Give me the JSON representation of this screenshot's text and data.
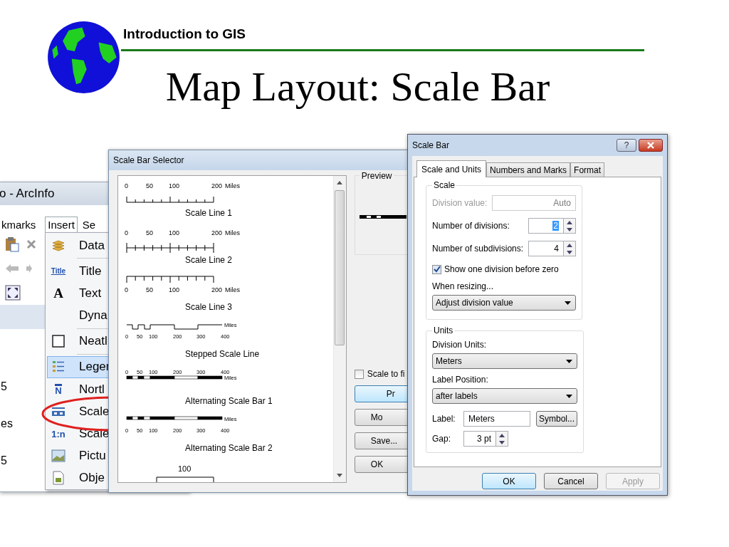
{
  "slide": {
    "header": "Introduction to GIS",
    "title": "Map Layout: Scale Bar"
  },
  "arcinfo_window": {
    "title": "o - ArcInfo",
    "menus": [
      {
        "label": "kmarks",
        "selected": false
      },
      {
        "label": "Insert",
        "selected": true
      },
      {
        "label": "Se",
        "selected": false
      }
    ],
    "side_texts": [
      "5",
      "es",
      "5"
    ],
    "insert_menu": [
      {
        "items": [
          {
            "label": "Data",
            "kind": "layers",
            "selected": false
          }
        ]
      },
      {
        "items": [
          {
            "label": "Title",
            "kind": "title",
            "icon_text": "Title",
            "selected": false
          },
          {
            "label": "Text",
            "kind": "text",
            "icon_text": "A",
            "selected": false
          },
          {
            "label": "Dyna",
            "kind": "none",
            "selected": false
          }
        ]
      },
      {
        "items": [
          {
            "label": "Neatl",
            "kind": "frame",
            "selected": false
          }
        ]
      },
      {
        "items": [
          {
            "label": "Leger",
            "kind": "legend",
            "selected": true
          },
          {
            "label": "Nortl",
            "kind": "north",
            "icon_text": "N",
            "selected": false
          },
          {
            "label": "Scale",
            "kind": "scalebar",
            "selected": false
          },
          {
            "label": "Scale",
            "kind": "scaletext",
            "icon_text": "1:n",
            "selected": false
          },
          {
            "label": "Pictu",
            "kind": "picture",
            "selected": false
          },
          {
            "label": "Obje",
            "kind": "object",
            "selected": false
          }
        ]
      }
    ]
  },
  "selector": {
    "title": "Scale Bar Selector",
    "styles": [
      {
        "kind": "line-up",
        "name": "Scale Line 1",
        "ticks": [
          "0",
          "50",
          "100",
          "200"
        ],
        "units": "Miles"
      },
      {
        "kind": "line-cross",
        "name": "Scale Line 2",
        "ticks": [
          "0",
          "50",
          "100",
          "200"
        ],
        "units": "Miles"
      },
      {
        "kind": "line-down",
        "name": "Scale Line 3",
        "ticks": [
          "0",
          "50",
          "100",
          "200"
        ],
        "units": "Miles"
      },
      {
        "kind": "stepped",
        "name": "Stepped Scale Line",
        "ticks": [
          "0",
          "50",
          "100",
          "200",
          "300",
          "400"
        ],
        "units": "Miles"
      },
      {
        "kind": "alt-above",
        "name": "Alternating Scale Bar 1",
        "ticks": [
          "0",
          "50",
          "100",
          "200",
          "300",
          "400"
        ],
        "units": "Miles"
      },
      {
        "kind": "alt-below",
        "name": "Alternating Scale Bar 2",
        "ticks": [
          "0",
          "50",
          "100",
          "200",
          "300",
          "400"
        ],
        "units": "Miles"
      },
      {
        "kind": "hollow",
        "ticks": [
          "100"
        ]
      }
    ],
    "preview_label": "Preview",
    "scale_to_fit": {
      "label": "Scale to fi",
      "checked": false
    },
    "buttons": [
      {
        "label": "Pr",
        "default": true
      },
      {
        "label": "Mo",
        "default": false
      },
      {
        "label": "Save...",
        "default": false
      },
      {
        "label": "OK",
        "default": false
      }
    ]
  },
  "scale_bar_dialog": {
    "title": "Scale Bar",
    "help": "?",
    "tabs": [
      {
        "label": "Scale and Units",
        "selected": true
      },
      {
        "label": "Numbers and Marks",
        "selected": false
      },
      {
        "label": "Format",
        "selected": false
      }
    ],
    "scale_group": {
      "title": "Scale",
      "division_value": {
        "label": "Division value:",
        "value": "Auto",
        "disabled": true
      },
      "divisions": {
        "label": "Number of divisions:",
        "value": "2",
        "text_selected": true
      },
      "subdivisions": {
        "label": "Number of subdivisions:",
        "value": "4",
        "text_selected": false
      },
      "show_before_zero": {
        "label": "Show one division before zero",
        "checked": true
      },
      "resizing_label": "When resizing...",
      "resizing": "Adjust division value"
    },
    "units_group": {
      "title": "Units",
      "division_units_label": "Division Units:",
      "division_units": "Meters",
      "label_position_label": "Label Position:",
      "label_position": "after labels",
      "label_label": "Label:",
      "label_value": "Meters",
      "symbol_button": "Symbol...",
      "gap_label": "Gap:",
      "gap": "3 pt"
    },
    "buttons": [
      {
        "label": "OK",
        "default": true,
        "disabled": false
      },
      {
        "label": "Cancel",
        "default": false,
        "disabled": false
      },
      {
        "label": "Apply",
        "default": false,
        "disabled": true
      }
    ]
  }
}
